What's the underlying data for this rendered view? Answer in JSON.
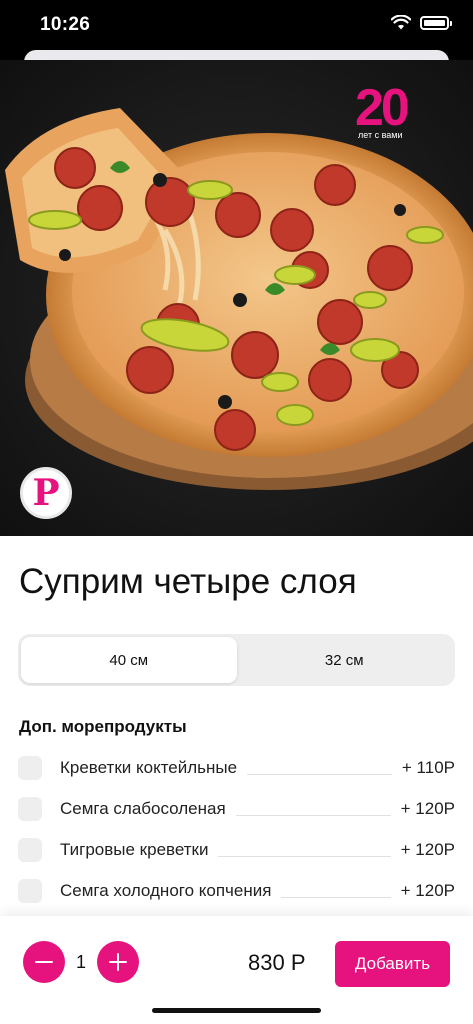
{
  "status_bar": {
    "time": "10:26"
  },
  "hero": {
    "badge_number": "20",
    "badge_text": "лет с вами",
    "logo_letter": "P"
  },
  "product": {
    "title": "Суприм четыре слоя",
    "sizes": [
      {
        "label": "40 см",
        "selected": true
      },
      {
        "label": "32 см",
        "selected": false
      }
    ]
  },
  "addons": {
    "section_title": "Доп. морепродукты",
    "items": [
      {
        "name": "Креветки коктейльные",
        "price": "+ 110Р",
        "checked": false
      },
      {
        "name": "Семга слабосоленая",
        "price": "+ 120Р",
        "checked": false
      },
      {
        "name": "Тигровые креветки",
        "price": "+ 120Р",
        "checked": false
      },
      {
        "name": "Семга холодного копчения",
        "price": "+ 120Р",
        "checked": false
      }
    ]
  },
  "cart_bar": {
    "quantity": "1",
    "total": "830 Р",
    "add_label": "Добавить"
  },
  "colors": {
    "accent": "#e6127d",
    "switch_bg": "#eeeeef"
  }
}
